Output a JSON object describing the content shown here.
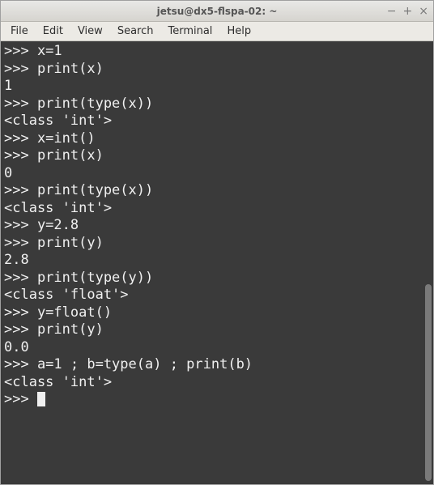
{
  "window": {
    "title": "jetsu@dx5-flspa-02: ~"
  },
  "menubar": {
    "items": [
      "File",
      "Edit",
      "View",
      "Search",
      "Terminal",
      "Help"
    ]
  },
  "terminal": {
    "lines": [
      ">>> x=1",
      ">>> print(x)",
      "1",
      ">>> print(type(x))",
      "<class 'int'>",
      ">>> x=int()",
      ">>> print(x)",
      "0",
      ">>> print(type(x))",
      "<class 'int'>",
      ">>> y=2.8",
      ">>> print(y)",
      "2.8",
      ">>> print(type(y))",
      "<class 'float'>",
      ">>> y=float()",
      ">>> print(y)",
      "0.0",
      ">>> a=1 ; b=type(a) ; print(b)",
      "<class 'int'>"
    ],
    "prompt": ">>> "
  }
}
